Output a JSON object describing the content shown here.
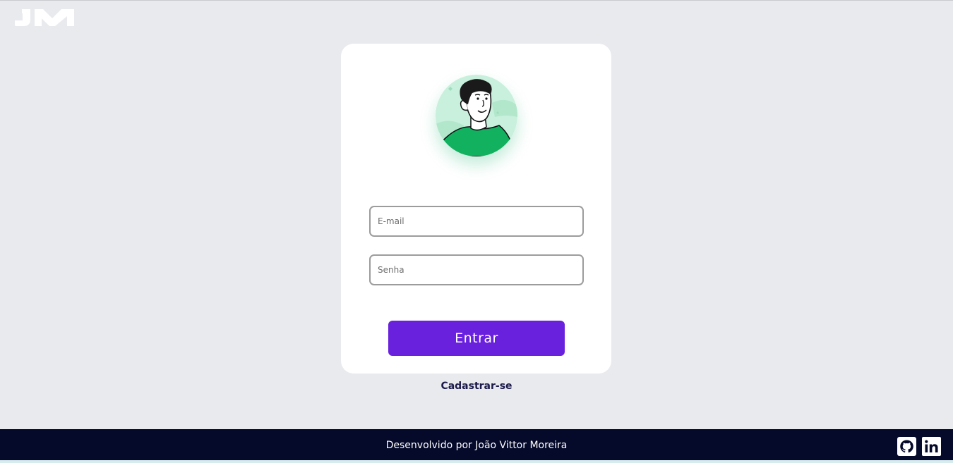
{
  "brand": {
    "logo_text": "JM"
  },
  "login_form": {
    "email_placeholder": "E-mail",
    "password_placeholder": "Senha",
    "submit_label": "Entrar"
  },
  "signup": {
    "label": "Cadastrar-se"
  },
  "footer": {
    "credit": "Desenvolvido por João Vittor Moreira",
    "icons": [
      "github-icon",
      "linkedin-icon"
    ]
  },
  "colors": {
    "page_bg": "#e9eaee",
    "card_bg": "#ffffff",
    "primary": "#6a21de",
    "footer_bg": "#050a2a",
    "signup_text": "#1b1a4a",
    "avatar_bg": "#c8f0dc",
    "shirt": "#12b15f"
  }
}
